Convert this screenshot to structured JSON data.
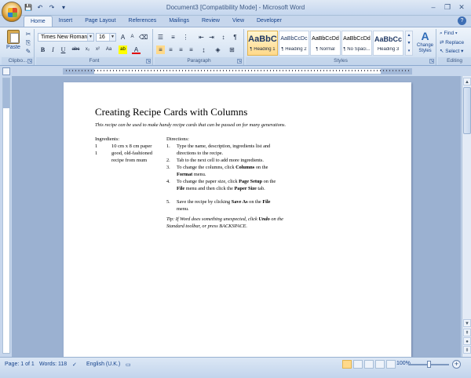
{
  "window": {
    "title": "Document3 [Compatibility Mode] - Microsoft Word"
  },
  "qat": {
    "save": "💾",
    "undo": "↶",
    "redo": "↷",
    "more": "▾"
  },
  "ribbon": {
    "tabs": [
      "Home",
      "Insert",
      "Page Layout",
      "References",
      "Mailings",
      "Review",
      "View",
      "Developer"
    ],
    "clipboard": {
      "paste": "Paste",
      "label": "Clipbo..."
    },
    "font": {
      "name": "Times New Roman",
      "size": "16",
      "label": "Font"
    },
    "paragraph": {
      "label": "Paragraph"
    },
    "styles": {
      "label": "Styles",
      "tiles": [
        {
          "sample": "AaBbC",
          "name": "¶ Heading 1"
        },
        {
          "sample": "AaBbCcDc",
          "name": "¶ Heading 2"
        },
        {
          "sample": "AaBbCcDd",
          "name": "¶ Normal"
        },
        {
          "sample": "AaBbCcDd",
          "name": "¶ No Spaci..."
        },
        {
          "sample": "AaBbCc",
          "name": "Heading 3"
        }
      ],
      "change": "Change Styles"
    },
    "editing": {
      "find": "Find",
      "replace": "Replace",
      "select": "Select",
      "label": "Editing"
    }
  },
  "document": {
    "title": "Creating Recipe Cards with Columns",
    "intro": "This recipe can be used to make handy recipe cards that can be passed on for many generations.",
    "ingredients_heading": "Ingredients:",
    "ingredients": [
      {
        "n": "1",
        "t": "10 cm x 8 cm paper"
      },
      {
        "n": "1",
        "t": "good, old-fashioned recipe from mum"
      }
    ],
    "directions_heading": "Directions:",
    "steps": [
      {
        "n": "1.",
        "parts": [
          "Type the name, description, ingredients list and directions to the recipe."
        ]
      },
      {
        "n": "2.",
        "parts": [
          "Tab to the next cell to add more ingredients."
        ]
      },
      {
        "n": "3.",
        "parts": [
          "To change the columns, click ",
          "Columns",
          " on the ",
          "Format",
          " menu."
        ]
      },
      {
        "n": "4.",
        "parts": [
          "To change the paper size, click ",
          "Page Setup",
          " on the ",
          "File",
          " menu and then click the ",
          "Paper Size",
          " tab."
        ]
      },
      {
        "n": "5.",
        "parts": [
          "Save the recipe by clicking ",
          "Save As",
          " on the ",
          "File",
          " menu."
        ]
      }
    ],
    "tip": [
      "Tip:  If Word does something unexpected, click ",
      "Undo",
      " on the Standard toolbar, or press BACKSPACE."
    ]
  },
  "status": {
    "page": "Page: 1 of 1",
    "words": "Words: 118",
    "language": "English (U.K.)",
    "zoom": "100%",
    "zoom_level_percent": 100
  }
}
